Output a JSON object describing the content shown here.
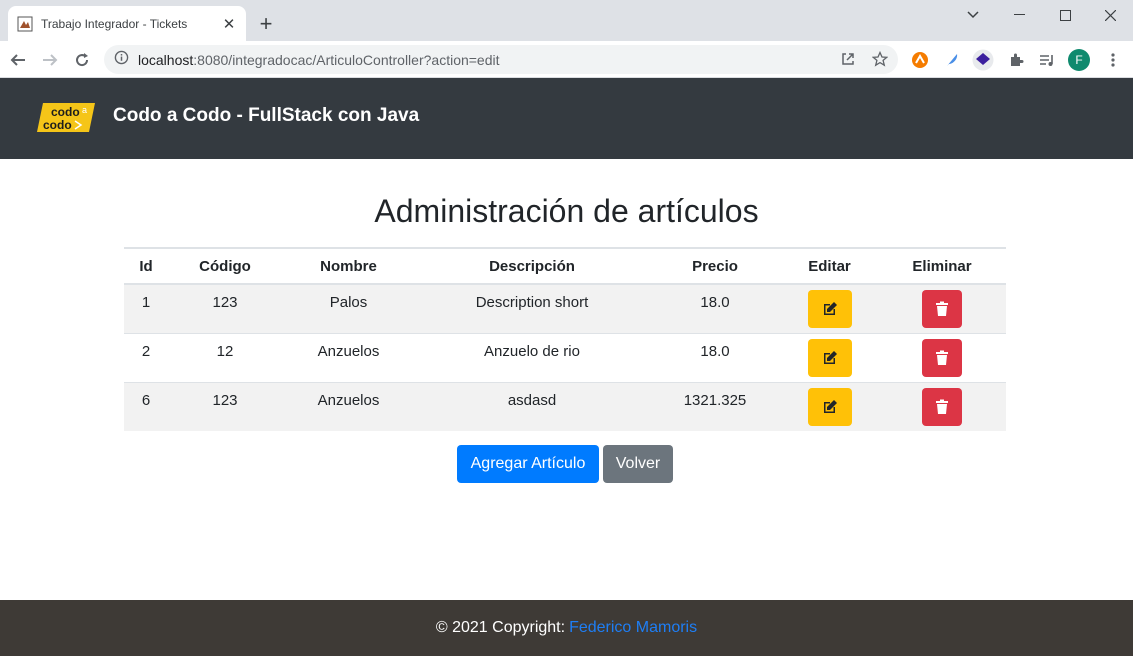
{
  "browser": {
    "tab_title": "Trabajo Integrador - Tickets",
    "url_host": "localhost",
    "url_rest": ":8080/integradocac/ArticuloController?action=edit",
    "profile_initial": "F"
  },
  "header": {
    "logo_line1": "codo",
    "logo_a": "a",
    "logo_line2": "codo",
    "brand": "Codo a Codo - FullStack con Java"
  },
  "main": {
    "title": "Administración de artículos",
    "columns": [
      "Id",
      "Código",
      "Nombre",
      "Descripción",
      "Precio",
      "Editar",
      "Eliminar"
    ],
    "rows": [
      {
        "id": "1",
        "codigo": "123",
        "nombre": "Palos",
        "descripcion": "Description short",
        "precio": "18.0"
      },
      {
        "id": "2",
        "codigo": "12",
        "nombre": "Anzuelos",
        "descripcion": "Anzuelo de rio",
        "precio": "18.0"
      },
      {
        "id": "6",
        "codigo": "123",
        "nombre": "Anzuelos",
        "descripcion": "asdasd",
        "precio": "1321.325"
      }
    ],
    "add_button": "Agregar Artículo",
    "back_button": "Volver"
  },
  "footer": {
    "copyright": "© 2021 Copyright:",
    "author": "Federico Mamoris"
  },
  "colors": {
    "header_bg": "#343a40",
    "edit": "#ffc107",
    "delete": "#dc3545",
    "primary": "#007bff",
    "secondary": "#6c757d",
    "footer_bg": "#3e3a36"
  }
}
